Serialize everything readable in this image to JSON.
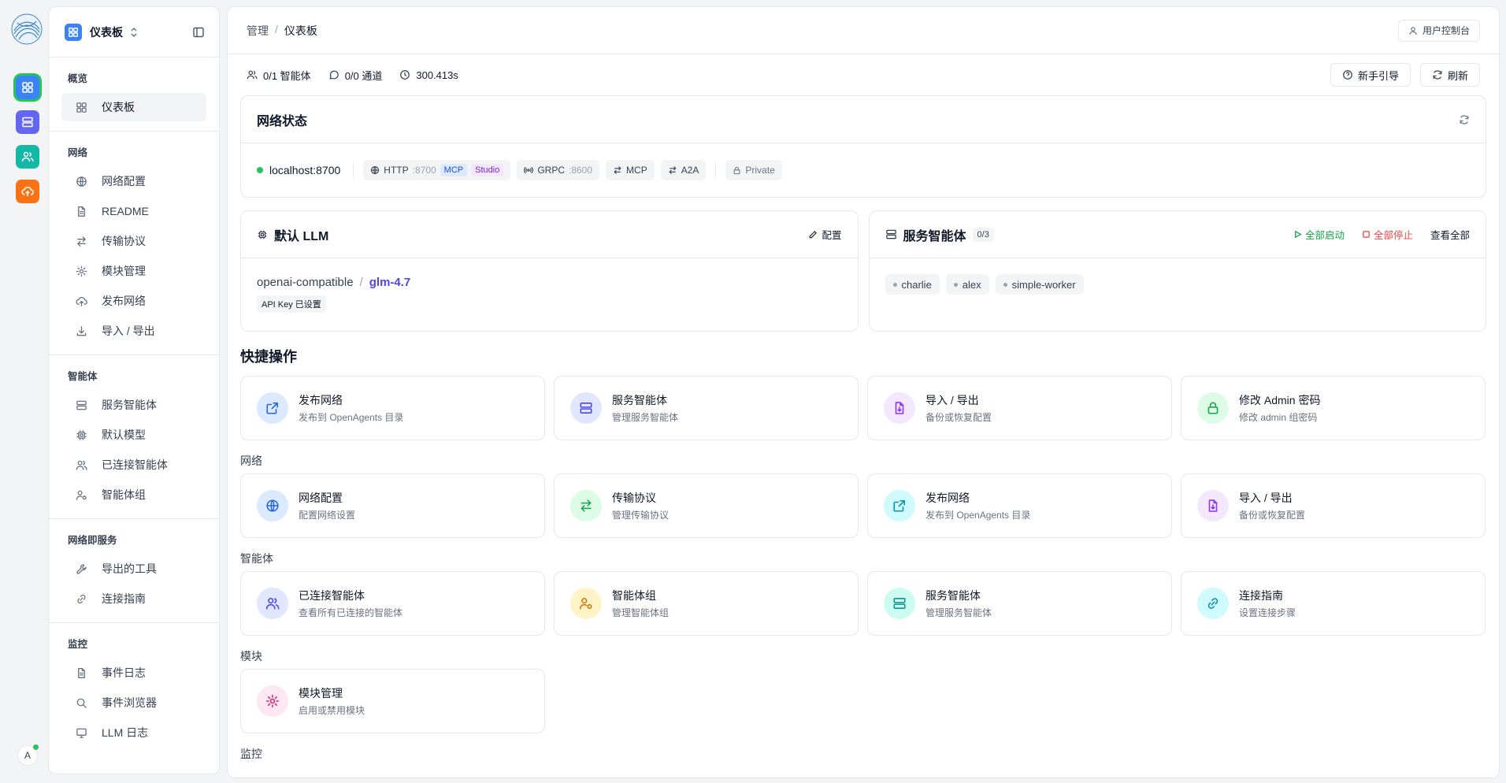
{
  "rail": {
    "avatar_letter": "A",
    "buttons": [
      {
        "icon": "grid-icon",
        "color": "#3b82f6"
      },
      {
        "icon": "server-icon",
        "color": "#6366f1"
      },
      {
        "icon": "users-icon",
        "color": "#14b8a6"
      },
      {
        "icon": "cloud-upload-icon",
        "color": "#f97316"
      }
    ]
  },
  "sidebar": {
    "title": "仪表板",
    "sections": [
      {
        "title": "概览",
        "items": [
          {
            "label": "仪表板",
            "icon": "grid-icon",
            "active": true
          }
        ]
      },
      {
        "title": "网络",
        "items": [
          {
            "label": "网络配置",
            "icon": "globe-icon"
          },
          {
            "label": "README",
            "icon": "file-icon"
          },
          {
            "label": "传输协议",
            "icon": "arrows-icon"
          },
          {
            "label": "模块管理",
            "icon": "gear-icon"
          },
          {
            "label": "发布网络",
            "icon": "cloud-upload-icon"
          },
          {
            "label": "导入 / 导出",
            "icon": "download-icon"
          }
        ]
      },
      {
        "title": "智能体",
        "items": [
          {
            "label": "服务智能体",
            "icon": "server-icon"
          },
          {
            "label": "默认模型",
            "icon": "cpu-icon"
          },
          {
            "label": "已连接智能体",
            "icon": "users-icon"
          },
          {
            "label": "智能体组",
            "icon": "user-group-icon"
          }
        ]
      },
      {
        "title": "网络即服务",
        "items": [
          {
            "label": "导出的工具",
            "icon": "wrench-icon"
          },
          {
            "label": "连接指南",
            "icon": "link-icon"
          }
        ]
      },
      {
        "title": "监控",
        "items": [
          {
            "label": "事件日志",
            "icon": "file-icon"
          },
          {
            "label": "事件浏览器",
            "icon": "search-icon"
          },
          {
            "label": "LLM 日志",
            "icon": "monitor-icon"
          }
        ]
      }
    ]
  },
  "header": {
    "breadcrumb": [
      "管理",
      "仪表板"
    ],
    "user_console": "用户控制台"
  },
  "stats": {
    "agents": "0/1 智能体",
    "channels": "0/0 通道",
    "uptime": "300.413s",
    "guide_button": "新手引导",
    "refresh_button": "刷新"
  },
  "network": {
    "title": "网络状态",
    "host": "localhost:8700",
    "http_label": "HTTP",
    "http_port": ":8700",
    "mcp_tag": "MCP",
    "studio_tag": "Studio",
    "grpc_label": "GRPC",
    "grpc_port": ":8600",
    "mcp_label": "MCP",
    "a2a_label": "A2A",
    "private_label": "Private"
  },
  "llm": {
    "title": "默认 LLM",
    "config": "配置",
    "provider": "openai-compatible",
    "sep": "/",
    "model": "glm-4.7",
    "key_badge": "API Key 已设置"
  },
  "service_agents": {
    "title": "服务智能体",
    "count": "0/3",
    "start_all": "全部启动",
    "stop_all": "全部停止",
    "view_all": "查看全部",
    "agents": [
      "charlie",
      "alex",
      "simple-worker"
    ]
  },
  "quick": {
    "title": "快捷操作",
    "top": [
      {
        "title": "发布网络",
        "desc": "发布到 OpenAgents 目录",
        "icon": "external-link-icon",
        "bg": "#dbeafe",
        "fg": "#2563eb"
      },
      {
        "title": "服务智能体",
        "desc": "管理服务智能体",
        "icon": "server-icon",
        "bg": "#e0e7ff",
        "fg": "#4f46e5"
      },
      {
        "title": "导入 / 导出",
        "desc": "备份或恢复配置",
        "icon": "file-download-icon",
        "bg": "#f3e8ff",
        "fg": "#9333ea"
      },
      {
        "title": "修改 Admin 密码",
        "desc": "修改 admin 组密码",
        "icon": "lock-icon",
        "bg": "#dcfce7",
        "fg": "#16a34a"
      }
    ],
    "groups": [
      {
        "title": "网络",
        "items": [
          {
            "title": "网络配置",
            "desc": "配置网络设置",
            "icon": "globe-icon",
            "bg": "#dbeafe",
            "fg": "#2563eb"
          },
          {
            "title": "传输协议",
            "desc": "管理传输协议",
            "icon": "arrows-icon",
            "bg": "#dcfce7",
            "fg": "#16a34a"
          },
          {
            "title": "发布网络",
            "desc": "发布到 OpenAgents 目录",
            "icon": "external-link-icon",
            "bg": "#cffafe",
            "fg": "#0891b2"
          },
          {
            "title": "导入 / 导出",
            "desc": "备份或恢复配置",
            "icon": "file-download-icon",
            "bg": "#f3e8ff",
            "fg": "#9333ea"
          }
        ]
      },
      {
        "title": "智能体",
        "items": [
          {
            "title": "已连接智能体",
            "desc": "查看所有已连接的智能体",
            "icon": "users-icon",
            "bg": "#e0e7ff",
            "fg": "#4f46e5"
          },
          {
            "title": "智能体组",
            "desc": "管理智能体组",
            "icon": "user-group-icon",
            "bg": "#fef3c7",
            "fg": "#d97706"
          },
          {
            "title": "服务智能体",
            "desc": "管理服务智能体",
            "icon": "server-icon",
            "bg": "#ccfbf1",
            "fg": "#0d9488"
          },
          {
            "title": "连接指南",
            "desc": "设置连接步骤",
            "icon": "link-icon",
            "bg": "#cffafe",
            "fg": "#0891b2"
          }
        ]
      },
      {
        "title": "模块",
        "items": [
          {
            "title": "模块管理",
            "desc": "启用或禁用模块",
            "icon": "gear-icon",
            "bg": "#fce7f3",
            "fg": "#db2777"
          }
        ]
      }
    ],
    "cut_group_title": "监控"
  }
}
